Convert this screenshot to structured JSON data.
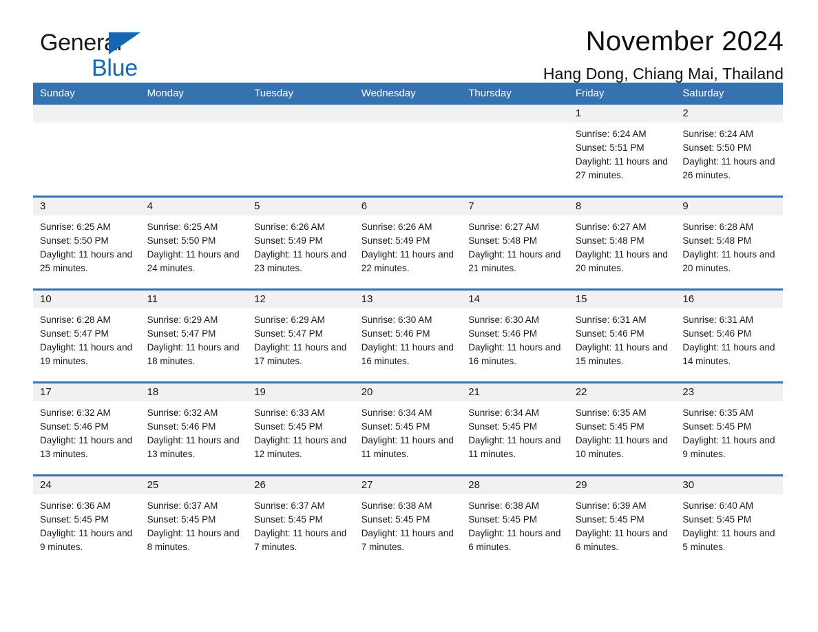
{
  "brand": {
    "name_part1": "General",
    "name_part2": "Blue",
    "triangle_color": "#1567b2",
    "blue_text_color": "#1669b8"
  },
  "header": {
    "month_title": "November 2024",
    "location": "Hang Dong, Chiang Mai, Thailand"
  },
  "theme": {
    "header_blue": "#3572b0",
    "daynum_band": "#f1f1f1",
    "cell_background": "#ffffff",
    "text": "#1a1a1a"
  },
  "calendar": {
    "weekday_headers": [
      "Sunday",
      "Monday",
      "Tuesday",
      "Wednesday",
      "Thursday",
      "Friday",
      "Saturday"
    ],
    "weeks": [
      [
        {
          "day": "",
          "sunrise": "",
          "sunset": "",
          "daylight": "",
          "empty": true
        },
        {
          "day": "",
          "sunrise": "",
          "sunset": "",
          "daylight": "",
          "empty": true
        },
        {
          "day": "",
          "sunrise": "",
          "sunset": "",
          "daylight": "",
          "empty": true
        },
        {
          "day": "",
          "sunrise": "",
          "sunset": "",
          "daylight": "",
          "empty": true
        },
        {
          "day": "",
          "sunrise": "",
          "sunset": "",
          "daylight": "",
          "empty": true
        },
        {
          "day": "1",
          "sunrise": "Sunrise: 6:24 AM",
          "sunset": "Sunset: 5:51 PM",
          "daylight": "Daylight: 11 hours and 27 minutes.",
          "empty": false
        },
        {
          "day": "2",
          "sunrise": "Sunrise: 6:24 AM",
          "sunset": "Sunset: 5:50 PM",
          "daylight": "Daylight: 11 hours and 26 minutes.",
          "empty": false
        }
      ],
      [
        {
          "day": "3",
          "sunrise": "Sunrise: 6:25 AM",
          "sunset": "Sunset: 5:50 PM",
          "daylight": "Daylight: 11 hours and 25 minutes.",
          "empty": false
        },
        {
          "day": "4",
          "sunrise": "Sunrise: 6:25 AM",
          "sunset": "Sunset: 5:50 PM",
          "daylight": "Daylight: 11 hours and 24 minutes.",
          "empty": false
        },
        {
          "day": "5",
          "sunrise": "Sunrise: 6:26 AM",
          "sunset": "Sunset: 5:49 PM",
          "daylight": "Daylight: 11 hours and 23 minutes.",
          "empty": false
        },
        {
          "day": "6",
          "sunrise": "Sunrise: 6:26 AM",
          "sunset": "Sunset: 5:49 PM",
          "daylight": "Daylight: 11 hours and 22 minutes.",
          "empty": false
        },
        {
          "day": "7",
          "sunrise": "Sunrise: 6:27 AM",
          "sunset": "Sunset: 5:48 PM",
          "daylight": "Daylight: 11 hours and 21 minutes.",
          "empty": false
        },
        {
          "day": "8",
          "sunrise": "Sunrise: 6:27 AM",
          "sunset": "Sunset: 5:48 PM",
          "daylight": "Daylight: 11 hours and 20 minutes.",
          "empty": false
        },
        {
          "day": "9",
          "sunrise": "Sunrise: 6:28 AM",
          "sunset": "Sunset: 5:48 PM",
          "daylight": "Daylight: 11 hours and 20 minutes.",
          "empty": false
        }
      ],
      [
        {
          "day": "10",
          "sunrise": "Sunrise: 6:28 AM",
          "sunset": "Sunset: 5:47 PM",
          "daylight": "Daylight: 11 hours and 19 minutes.",
          "empty": false
        },
        {
          "day": "11",
          "sunrise": "Sunrise: 6:29 AM",
          "sunset": "Sunset: 5:47 PM",
          "daylight": "Daylight: 11 hours and 18 minutes.",
          "empty": false
        },
        {
          "day": "12",
          "sunrise": "Sunrise: 6:29 AM",
          "sunset": "Sunset: 5:47 PM",
          "daylight": "Daylight: 11 hours and 17 minutes.",
          "empty": false
        },
        {
          "day": "13",
          "sunrise": "Sunrise: 6:30 AM",
          "sunset": "Sunset: 5:46 PM",
          "daylight": "Daylight: 11 hours and 16 minutes.",
          "empty": false
        },
        {
          "day": "14",
          "sunrise": "Sunrise: 6:30 AM",
          "sunset": "Sunset: 5:46 PM",
          "daylight": "Daylight: 11 hours and 16 minutes.",
          "empty": false
        },
        {
          "day": "15",
          "sunrise": "Sunrise: 6:31 AM",
          "sunset": "Sunset: 5:46 PM",
          "daylight": "Daylight: 11 hours and 15 minutes.",
          "empty": false
        },
        {
          "day": "16",
          "sunrise": "Sunrise: 6:31 AM",
          "sunset": "Sunset: 5:46 PM",
          "daylight": "Daylight: 11 hours and 14 minutes.",
          "empty": false
        }
      ],
      [
        {
          "day": "17",
          "sunrise": "Sunrise: 6:32 AM",
          "sunset": "Sunset: 5:46 PM",
          "daylight": "Daylight: 11 hours and 13 minutes.",
          "empty": false
        },
        {
          "day": "18",
          "sunrise": "Sunrise: 6:32 AM",
          "sunset": "Sunset: 5:46 PM",
          "daylight": "Daylight: 11 hours and 13 minutes.",
          "empty": false
        },
        {
          "day": "19",
          "sunrise": "Sunrise: 6:33 AM",
          "sunset": "Sunset: 5:45 PM",
          "daylight": "Daylight: 11 hours and 12 minutes.",
          "empty": false
        },
        {
          "day": "20",
          "sunrise": "Sunrise: 6:34 AM",
          "sunset": "Sunset: 5:45 PM",
          "daylight": "Daylight: 11 hours and 11 minutes.",
          "empty": false
        },
        {
          "day": "21",
          "sunrise": "Sunrise: 6:34 AM",
          "sunset": "Sunset: 5:45 PM",
          "daylight": "Daylight: 11 hours and 11 minutes.",
          "empty": false
        },
        {
          "day": "22",
          "sunrise": "Sunrise: 6:35 AM",
          "sunset": "Sunset: 5:45 PM",
          "daylight": "Daylight: 11 hours and 10 minutes.",
          "empty": false
        },
        {
          "day": "23",
          "sunrise": "Sunrise: 6:35 AM",
          "sunset": "Sunset: 5:45 PM",
          "daylight": "Daylight: 11 hours and 9 minutes.",
          "empty": false
        }
      ],
      [
        {
          "day": "24",
          "sunrise": "Sunrise: 6:36 AM",
          "sunset": "Sunset: 5:45 PM",
          "daylight": "Daylight: 11 hours and 9 minutes.",
          "empty": false
        },
        {
          "day": "25",
          "sunrise": "Sunrise: 6:37 AM",
          "sunset": "Sunset: 5:45 PM",
          "daylight": "Daylight: 11 hours and 8 minutes.",
          "empty": false
        },
        {
          "day": "26",
          "sunrise": "Sunrise: 6:37 AM",
          "sunset": "Sunset: 5:45 PM",
          "daylight": "Daylight: 11 hours and 7 minutes.",
          "empty": false
        },
        {
          "day": "27",
          "sunrise": "Sunrise: 6:38 AM",
          "sunset": "Sunset: 5:45 PM",
          "daylight": "Daylight: 11 hours and 7 minutes.",
          "empty": false
        },
        {
          "day": "28",
          "sunrise": "Sunrise: 6:38 AM",
          "sunset": "Sunset: 5:45 PM",
          "daylight": "Daylight: 11 hours and 6 minutes.",
          "empty": false
        },
        {
          "day": "29",
          "sunrise": "Sunrise: 6:39 AM",
          "sunset": "Sunset: 5:45 PM",
          "daylight": "Daylight: 11 hours and 6 minutes.",
          "empty": false
        },
        {
          "day": "30",
          "sunrise": "Sunrise: 6:40 AM",
          "sunset": "Sunset: 5:45 PM",
          "daylight": "Daylight: 11 hours and 5 minutes.",
          "empty": false
        }
      ]
    ]
  }
}
